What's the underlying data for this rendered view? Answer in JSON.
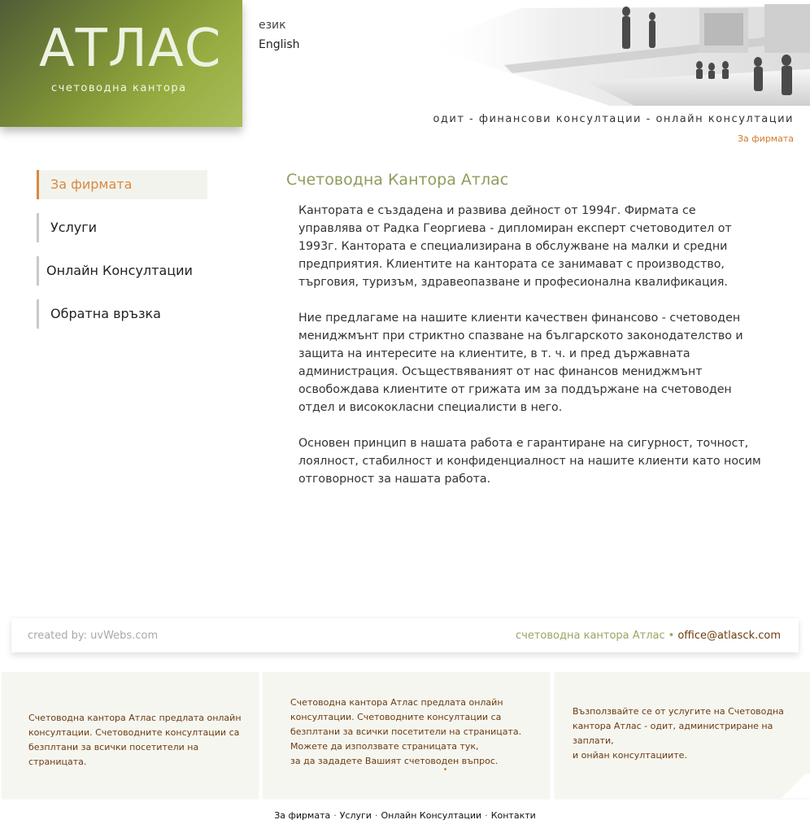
{
  "logo": {
    "title": "АТЛАС",
    "subtitle": "счетоводна кантора"
  },
  "language": {
    "label": "език",
    "link": "English"
  },
  "header": {
    "tagline": "одит - финансови консултации - онлайн консултации",
    "breadcrumb": "За фирмата"
  },
  "sidenav": {
    "items": [
      {
        "label": "За фирмата"
      },
      {
        "label": "Услуги"
      },
      {
        "label": "Онлайн Консултации"
      },
      {
        "label": "Обратна връзка"
      }
    ]
  },
  "main": {
    "title": "Счетоводна Кантора Атлас",
    "paragraphs": [
      "Кантората е създадена и развива дейност от 1994г. Фирмата се управлява от Радка Георгиева - дипломиран експерт счетоводител от 1993г. Кантората е специализирана в обслужване на малки и средни предприятия. Клиентите на кантората се занимават с производство, търговия, туризъм, здравеопазване и професионална квалификация.",
      "Ние предлагаме на нашите клиенти качествен финансово - счетоводен мениджмънт при стриктно спазване на българското законодателство и защита на интересите на клиентите, в т. ч. и пред държавната администрация. Осъществяваният от нас финансов мениджмънт освобождава клиентите от грижата им за поддържане на счетоводен отдел и висококласни специалисти в него.",
      "Основен принцип в нашата работа е гарантиране на сигурност, точност, лоялност, стабилност и конфиденциалност на нашите клиенти като носим отговорност за нашата работа."
    ]
  },
  "footer": {
    "created_by": "created by: uvWebs.com",
    "company": "счетоводна кантора Атлас",
    "bullet": "•",
    "email": "office@atlasck.com"
  },
  "boxes": [
    {
      "lines": [
        "Счетоводна кантора Атлас предлата онлайн",
        "консултации. Счетоводните консултации са",
        "безплтани за всички посетители на страницата."
      ]
    },
    {
      "lines": [
        "Счетоводна кантора Атлас предлата онлайн",
        "консултации. Счетоводните консултации са",
        "безплтани за всички посетители на страницата.",
        "Можете да използвате страницата тук,",
        "за да зададете Вашият счетоводен въпрос."
      ]
    },
    {
      "lines": [
        "Възползвайте се от услугите на Счетоводна",
        "кантора Атлас - одит, администриране на",
        "заплати,",
        "и онйан консултациите."
      ]
    }
  ],
  "bottom_nav": {
    "items": [
      "За фирмата",
      "Услуги",
      "Онлайн Консултации",
      "Контакти"
    ],
    "separator": "·"
  }
}
